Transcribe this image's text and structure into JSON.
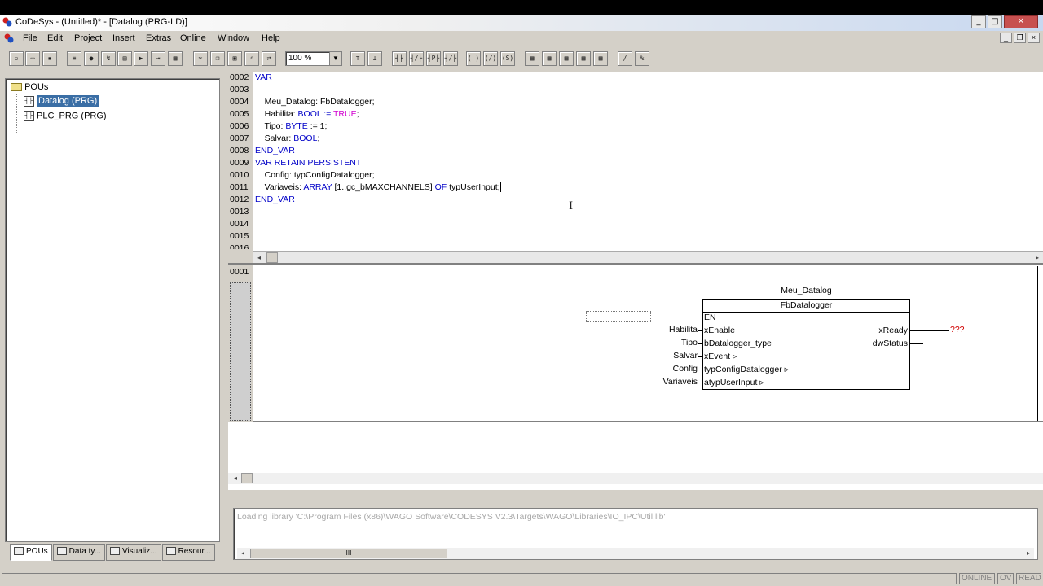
{
  "window": {
    "title": "CoDeSys - (Untitled)* - [Datalog (PRG-LD)]",
    "buttons": {
      "minimize": "_",
      "maximize": "□",
      "close": "✕"
    }
  },
  "menu": [
    "File",
    "Edit",
    "Project",
    "Insert",
    "Extras",
    "Online",
    "Window",
    "Help"
  ],
  "mdi_buttons": {
    "minimize": "_",
    "restore": "❐",
    "close": "×"
  },
  "toolbar": {
    "zoom": "100 %"
  },
  "toolbar_icons": [
    "new-icon",
    "open-icon",
    "save-icon",
    "build-icon",
    "stop-icon",
    "login-icon",
    "logout-icon",
    "run-icon",
    "step-icon",
    "cut-icon",
    "copy-icon",
    "paste-icon",
    "find-icon",
    "replace-icon",
    "contact-icon",
    "negated-contact-icon",
    "parallel-contact-icon",
    "parallel-negated-contact-icon",
    "coil-icon",
    "negated-coil-icon",
    "set-coil-icon",
    "box-icon",
    "box-en-icon",
    "jump-icon",
    "return-icon",
    "comment-icon",
    "pin-icon"
  ],
  "project_tree": {
    "root": "POUs",
    "items": [
      {
        "label": "Datalog (PRG)",
        "selected": true
      },
      {
        "label": "PLC_PRG (PRG)",
        "selected": false
      }
    ]
  },
  "tree_tabs": [
    "POUs",
    "Data ty...",
    "Visualiz...",
    "Resour..."
  ],
  "declaration": {
    "line_numbers": [
      "0002",
      "0003",
      "0004",
      "0005",
      "0006",
      "0007",
      "0008",
      "0009",
      "0010",
      "0011",
      "0012",
      "0013",
      "0014",
      "0015",
      "0016"
    ],
    "lines": [
      {
        "kw": "VAR",
        "text": "",
        "tail": ""
      },
      {
        "kw": "",
        "text": "",
        "tail": ""
      },
      {
        "kw": "",
        "text": "    Meu_Datalog: FbDatalogger;",
        "tail": ""
      },
      {
        "kw": "",
        "text": "    Habilita: ",
        "kw2": "BOOL := ",
        "tr": "TRUE",
        "tail": ";"
      },
      {
        "kw": "",
        "text": "    Tipo: ",
        "kw2": "BYTE",
        "tail": " := 1;"
      },
      {
        "kw": "",
        "text": "    Salvar: ",
        "kw2": "BOOL",
        "tail": ";"
      },
      {
        "kw": "END_VAR",
        "text": "",
        "tail": ""
      },
      {
        "kw": "VAR RETAIN PERSISTENT",
        "text": "",
        "tail": ""
      },
      {
        "kw": "",
        "text": "    Config: typConfigDatalogger;",
        "tail": ""
      },
      {
        "kw": "",
        "text": "    Variaveis: ",
        "kw2": "ARRAY",
        "tail": " [1..gc_bMAXCHANNELS] ",
        "kw3": "OF",
        "tail2": " typUserInput;"
      },
      {
        "kw": "END_VAR",
        "text": "",
        "tail": ""
      }
    ]
  },
  "ladder": {
    "network_number": "0001",
    "instance": "Meu_Datalog",
    "fb_type": "FbDatalogger",
    "inputs": [
      {
        "pin": "EN",
        "var": ""
      },
      {
        "pin": "xEnable",
        "var": "Habilita"
      },
      {
        "pin": "bDatalogger_type",
        "var": "Tipo"
      },
      {
        "pin": "xEvent ▹",
        "var": "Salvar"
      },
      {
        "pin": "typConfigDatalogger ▹",
        "var": "Config"
      },
      {
        "pin": "atypUserInput ▹",
        "var": "Variaveis"
      }
    ],
    "outputs": [
      {
        "pin": "xReady",
        "var": "???"
      },
      {
        "pin": "dwStatus",
        "var": ""
      }
    ],
    "unassigned_color": "#d00000"
  },
  "output_window": {
    "message": "Loading library 'C:\\Program Files (x86)\\WAGO Software\\CODESYS V2.3\\Targets\\WAGO\\Libraries\\IO_IPC\\Util.lib'",
    "scroll_grip": "III"
  },
  "status": [
    "ONLINE",
    "OV",
    "READ"
  ]
}
